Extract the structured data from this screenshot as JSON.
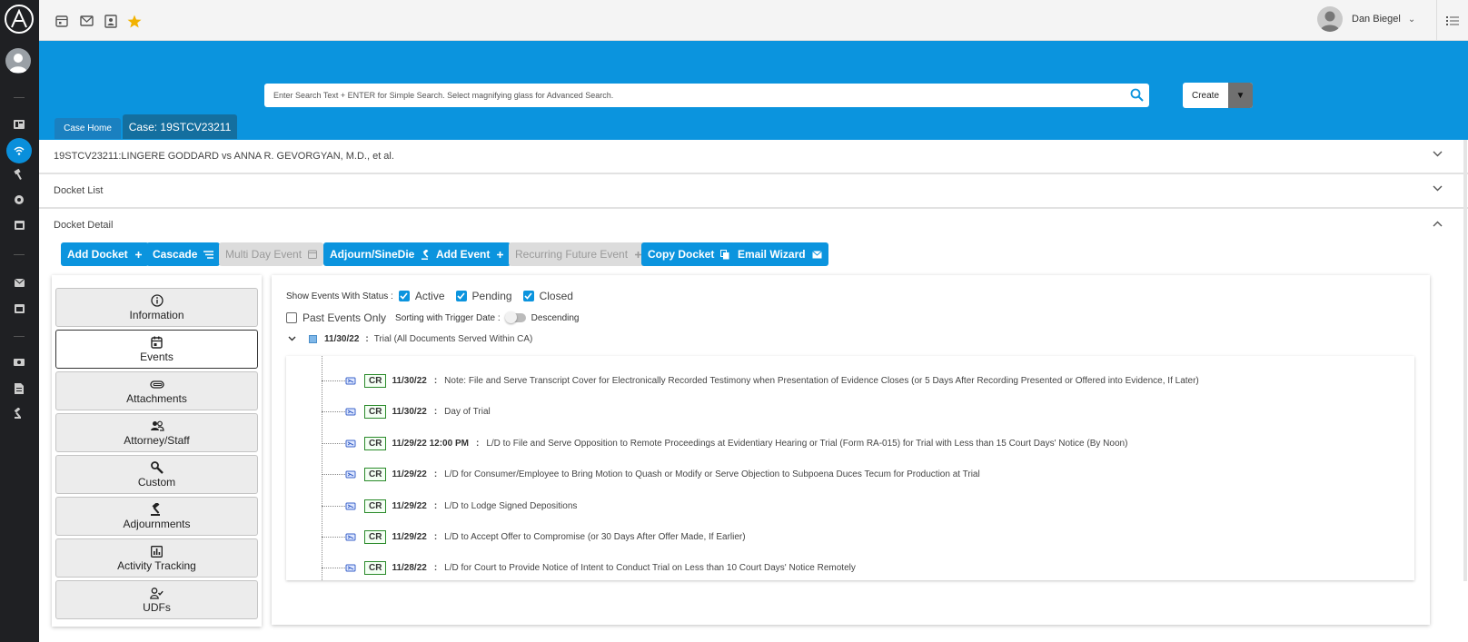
{
  "rail": {
    "icons": [
      "app-logo-icon",
      "user-avatar-icon",
      "dashboard-icon",
      "wifi-icon",
      "hammer-icon",
      "settings-icon",
      "calendar-icon",
      "mail-icon",
      "calendar-alt-icon",
      "screen-icon",
      "document-icon",
      "gavel-icon"
    ],
    "active": "wifi-icon"
  },
  "topbar": {
    "icons": [
      "calendar-icon",
      "mail-icon",
      "contact-card-icon",
      "star-icon"
    ],
    "user_name": "Dan Biegel",
    "star_color": "#f2b200"
  },
  "search": {
    "placeholder": "Enter Search Text + ENTER for Simple Search. Select magnifying glass for Advanced Search."
  },
  "create": {
    "label": "Create",
    "caret": "▼"
  },
  "tabs": {
    "home": "Case Home",
    "case": "Case: 19STCV23211"
  },
  "sections": {
    "case_title": "19STCV23211:LINGERE GODDARD vs ANNA R. GEVORGYAN, M.D., et al.",
    "docket_list": "Docket List",
    "docket_detail": "Docket Detail"
  },
  "actions": [
    {
      "label": "Add Docket",
      "icon": "plus-icon",
      "enabled": true
    },
    {
      "label": "Cascade",
      "icon": "list-icon",
      "enabled": true
    },
    {
      "label": "Multi Day Event",
      "icon": "calendar-icon",
      "enabled": false
    },
    {
      "label": "Adjourn/SineDie",
      "icon": "gavel-icon",
      "enabled": true
    },
    {
      "label": "Add Event",
      "icon": "plus-icon",
      "enabled": true
    },
    {
      "label": "Recurring Future Event",
      "icon": "plus-icon",
      "enabled": false
    },
    {
      "label": "Copy Docket",
      "icon": "copy-icon",
      "enabled": true
    },
    {
      "label": "Email Wizard",
      "icon": "email-icon",
      "enabled": true
    }
  ],
  "nav": [
    {
      "label": "Information",
      "icon": "info-icon"
    },
    {
      "label": "Events",
      "icon": "calendar-icon",
      "active": true
    },
    {
      "label": "Attachments",
      "icon": "paperclip-icon"
    },
    {
      "label": "Attorney/Staff",
      "icon": "people-icon"
    },
    {
      "label": "Custom",
      "icon": "wrench-icon"
    },
    {
      "label": "Adjournments",
      "icon": "gavel-icon"
    },
    {
      "label": "Activity Tracking",
      "icon": "chart-icon"
    },
    {
      "label": "UDFs",
      "icon": "user-check-icon"
    }
  ],
  "filters": {
    "label": "Show Events With Status :",
    "statuses": [
      {
        "label": "Active",
        "checked": true
      },
      {
        "label": "Pending",
        "checked": true
      },
      {
        "label": "Closed",
        "checked": true
      }
    ],
    "past_events_only": {
      "label": "Past Events Only",
      "checked": false
    },
    "sorting_label": "Sorting with Trigger Date :",
    "sorting_value": "Descending"
  },
  "parent_event": {
    "date": "11/30/22",
    "separator": ":",
    "title": "Trial (All Documents Served Within CA)"
  },
  "events": [
    {
      "tag": "CR",
      "date": "11/30/22",
      "text": "Note: File and Serve Transcript Cover for Electronically Recorded Testimony when Presentation of Evidence Closes (or 5 Days After Recording Presented or Offered into Evidence, If Later)"
    },
    {
      "tag": "CR",
      "date": "11/30/22",
      "text": "Day of Trial"
    },
    {
      "tag": "CR",
      "date": "11/29/22 12:00 PM",
      "text": "L/D to File and Serve Opposition to Remote Proceedings at Evidentiary Hearing or Trial (Form RA-015) for Trial with Less than 15 Court Days' Notice (By Noon)"
    },
    {
      "tag": "CR",
      "date": "11/29/22",
      "text": "L/D for Consumer/Employee to Bring Motion to Quash or Modify or Serve Objection to Subpoena Duces Tecum for Production at Trial"
    },
    {
      "tag": "CR",
      "date": "11/29/22",
      "text": "L/D to Lodge Signed Depositions"
    },
    {
      "tag": "CR",
      "date": "11/29/22",
      "text": "L/D to Accept Offer to Compromise (or 30 Days After Offer Made, If Earlier)"
    },
    {
      "tag": "CR",
      "date": "11/28/22",
      "text": "L/D for Court to Provide Notice of Intent to Conduct Trial on Less than 10 Court Days' Notice Remotely"
    }
  ],
  "colors": {
    "brand_blue": "#0b94de",
    "rail": "#1f2023",
    "cr_border": "#2a8a2a"
  }
}
